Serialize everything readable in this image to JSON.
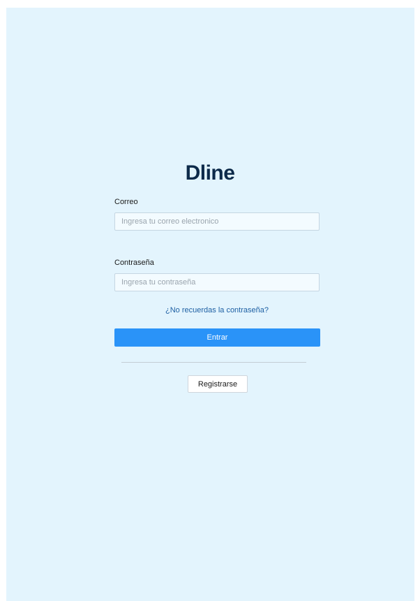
{
  "brand": {
    "logo_text": "Dline"
  },
  "form": {
    "email_label": "Correo",
    "email_placeholder": "Ingresa tu correo electronico",
    "password_label": "Contraseña",
    "password_placeholder": "Ingresa tu contraseña",
    "forgot_link": "¿No recuerdas la contraseña?",
    "submit_label": "Entrar",
    "register_label": "Registrarse"
  },
  "colors": {
    "page_background": "#e3f4fd",
    "brand_text": "#0d2a4a",
    "primary_button": "#2a93f8",
    "link": "#1d5fa3"
  }
}
